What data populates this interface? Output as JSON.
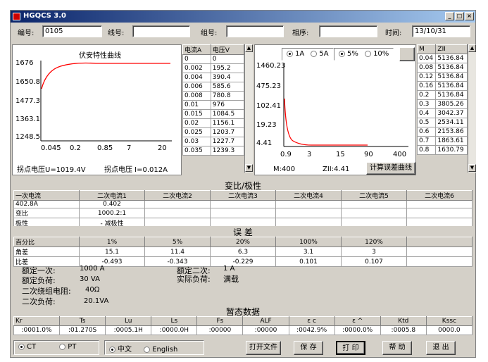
{
  "window": {
    "title": "HGQCS 3.0"
  },
  "header": {
    "serial_label": "编号:",
    "serial_value": "0105",
    "line_label": "线号:",
    "line_value": "",
    "group_label": "组号:",
    "group_value": "",
    "phase_label": "相序:",
    "phase_value": "",
    "time_label": "时间:",
    "time_value": "13/10/31"
  },
  "va_chart": {
    "title": "伏安特性曲线",
    "y_ticks": [
      "1676",
      "1650.8",
      "1477.3",
      "1363.1",
      "1248.5"
    ],
    "x_ticks": [
      "0.045",
      "0.2",
      "0.85",
      "7",
      "20"
    ],
    "knee_voltage": "拐点电压U=1019.4V",
    "knee_current": "拐点电压 I=0.012A"
  },
  "va_table": {
    "headers": [
      "电流A",
      "电压V"
    ],
    "rows": [
      [
        "0",
        "0"
      ],
      [
        "0.002",
        "195.2"
      ],
      [
        "0.004",
        "390.4"
      ],
      [
        "0.006",
        "585.6"
      ],
      [
        "0.008",
        "780.8"
      ],
      [
        "0.01",
        "976"
      ],
      [
        "0.015",
        "1084.5"
      ],
      [
        "0.02",
        "1156.1"
      ],
      [
        "0.025",
        "1203.7"
      ],
      [
        "0.03",
        "1227.7"
      ],
      [
        "0.035",
        "1239.3"
      ]
    ]
  },
  "err_chart": {
    "current_opts": [
      "1A",
      "5A"
    ],
    "current_selected": "1A",
    "pct_opts": [
      "5%",
      "10%"
    ],
    "pct_selected": "5%",
    "y_ticks": [
      "1460.23",
      "475.23",
      "102.41",
      "19.23",
      "4.41"
    ],
    "x_ticks": [
      "0.9",
      "3",
      "15",
      "90",
      "400"
    ],
    "m_readout": "M:400",
    "z_readout": "ZII:4.41",
    "calc_button": "计算误差曲线"
  },
  "mz_table": {
    "headers": [
      "M",
      "ZII"
    ],
    "rows": [
      [
        "0.04",
        "5136.84"
      ],
      [
        "0.08",
        "5136.84"
      ],
      [
        "0.12",
        "5136.84"
      ],
      [
        "0.16",
        "5136.84"
      ],
      [
        "0.2",
        "5136.84"
      ],
      [
        "0.3",
        "3805.26"
      ],
      [
        "0.4",
        "3042.37"
      ],
      [
        "0.5",
        "2534.11"
      ],
      [
        "0.6",
        "2153.86"
      ],
      [
        "0.7",
        "1863.61"
      ],
      [
        "0.8",
        "1630.79"
      ]
    ]
  },
  "ratio_section": {
    "title": "变比/极性",
    "headers": [
      "一次电流",
      "二次电流1",
      "二次电流2",
      "二次电流3",
      "二次电流4",
      "二次电流5",
      "二次电流6"
    ],
    "rows": [
      [
        "402.8A",
        "0.402",
        "",
        "",
        "",
        "",
        ""
      ],
      [
        "变比",
        "1000.2:1",
        "",
        "",
        "",
        "",
        ""
      ],
      [
        "极性",
        "- 减极性",
        "",
        "",
        "",
        "",
        ""
      ]
    ]
  },
  "error_section": {
    "title": "误    差",
    "headers": [
      "百分比",
      "1%",
      "5%",
      "20%",
      "100%",
      "120%",
      ""
    ],
    "rows": [
      [
        "角差",
        "15.1",
        "11.4",
        "6.3",
        "3.1",
        "3",
        ""
      ],
      [
        "比差",
        "-0.493",
        "-0.343",
        "-0.229",
        "0.101",
        "0.107",
        ""
      ]
    ]
  },
  "ratings": {
    "rated_primary_label": "额定一次:",
    "rated_primary_value": "1000  A",
    "rated_secondary_label": "额定二次:",
    "rated_secondary_value": "1  A",
    "rated_load_label": "额定负荷:",
    "rated_load_value": "30 VA",
    "actual_load_label": "实际负荷:",
    "actual_load_value": "满载",
    "winding_res_label": "二次绕组电阻:",
    "winding_res_value": "40Ω",
    "sec_load_label": "二次负荷:",
    "sec_load_value": "20.1VA"
  },
  "transient": {
    "title": "暂态数据",
    "headers": [
      "Kr",
      "Ts",
      "Lu",
      "Ls",
      "Fs",
      "ALF",
      "ε c",
      "ε ^",
      "Ktd",
      "Kssc"
    ],
    "values": [
      ":0001.0%",
      ":01.270S",
      ":0005.1H",
      ":0000.0H",
      ":00000",
      ":00000",
      ":0042.9%",
      ":0000.0%",
      ":0005.8",
      "0000.0"
    ]
  },
  "footer": {
    "ct_label": "CT",
    "pt_label": "PT",
    "ct_selected": true,
    "chinese_label": "中文",
    "english_label": "English",
    "chinese_selected": true,
    "open_file": "打开文件",
    "save": "保 存",
    "print": "打 印",
    "help": "帮 助",
    "exit": "退 出"
  },
  "colors": {
    "titlebar": "#0a246a",
    "curve": "#ff0000",
    "face": "#d4d0c8"
  }
}
